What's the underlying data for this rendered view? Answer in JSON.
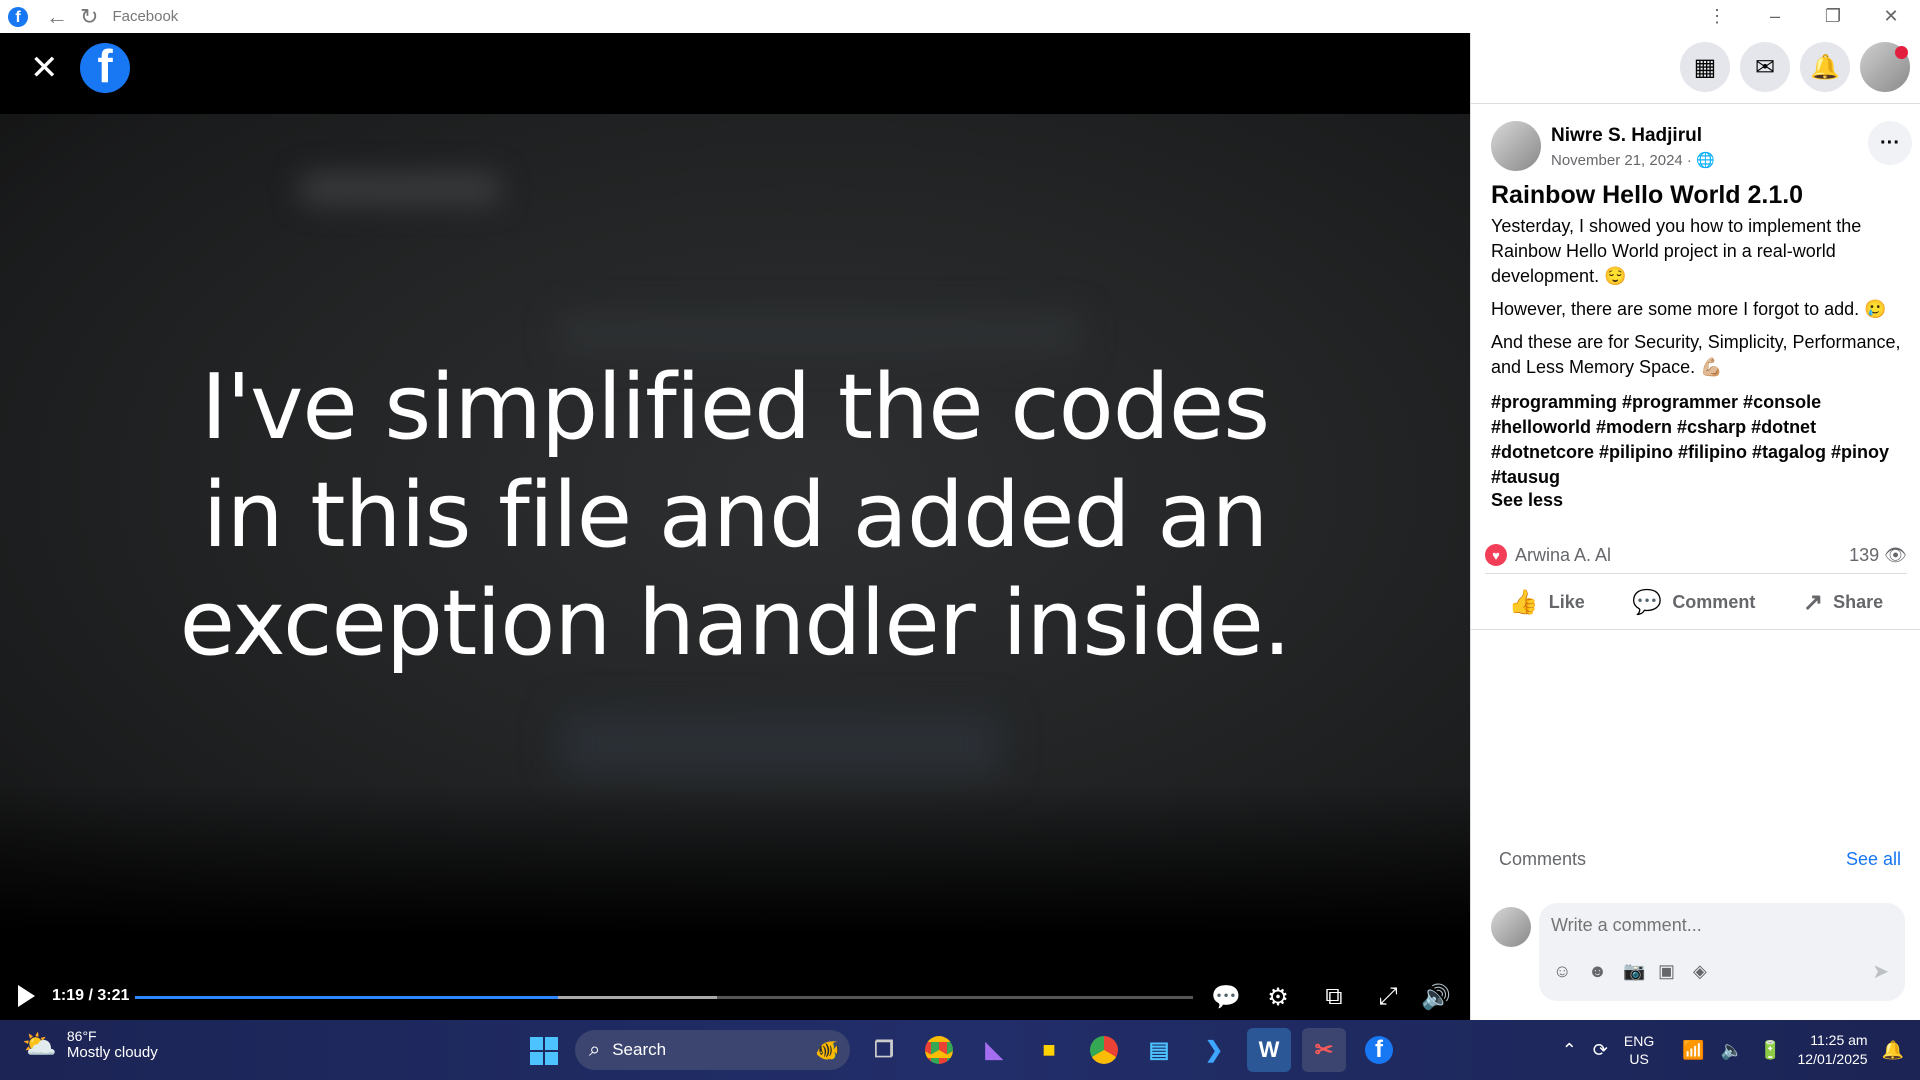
{
  "browser": {
    "title": "Facebook"
  },
  "video": {
    "caption_line1": "I've simplified the codes",
    "caption_line2": "in this file and added an",
    "caption_line3": "exception handler inside.",
    "time": "1:19 / 3:21",
    "progress_fraction": 0.4,
    "buffered_fraction": 0.55
  },
  "post": {
    "author": "Niwre S. Hadjirul",
    "date": "November 21, 2024 ·",
    "title": "Rainbow Hello World 2.1.0",
    "para1": "Yesterday, I showed you how to implement the Rainbow Hello World project in a real-world development. 😌",
    "para2": "However, there are some more I forgot to add. 🥲",
    "para3": "And these are for Security, Simplicity, Performance, and Less Memory Space. 💪🏼",
    "hashtags": "#programming #programmer #console #helloworld #modern #csharp #dotnet #dotnetcore #pilipino #filipino #tagalog #pinoy #tausug",
    "see_less": "See less",
    "reacted_by": "Arwina A. Al",
    "views": "139",
    "like_label": "Like",
    "comment_label": "Comment",
    "share_label": "Share"
  },
  "comments": {
    "heading": "Comments",
    "see_all": "See all",
    "placeholder": "Write a comment..."
  },
  "taskbar": {
    "temperature": "86°F",
    "condition": "Mostly cloudy",
    "search_label": "Search",
    "lang1": "ENG",
    "lang2": "US",
    "time": "11:25 am",
    "date": "12/01/2025"
  },
  "colors": {
    "facebook_blue": "#1877f2",
    "progress_blue": "#2d88ff",
    "notification_red": "#e41e3f"
  }
}
